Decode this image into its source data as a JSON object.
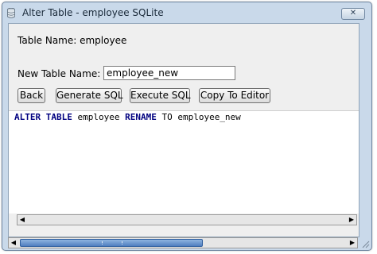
{
  "window": {
    "title": "Alter Table - employee SQLite",
    "close_glyph": "✕",
    "icon": "database-icon"
  },
  "form": {
    "table_name_label": "Table Name: employee",
    "new_table_name_label": "New Table Name:",
    "new_table_name_value": "employee_new"
  },
  "buttons": {
    "back": "Back",
    "generate_sql": "Generate SQL",
    "execute_sql": "Execute SQL",
    "copy_to_editor": "Copy To Editor"
  },
  "editor": {
    "sql": {
      "kw1": "ALTER TABLE",
      "t1": " employee ",
      "kw2": "RENAME",
      "t2": " TO employee_new"
    },
    "keyword_color": "#000080"
  },
  "scrollbars": {
    "left_arrow": "◀",
    "right_arrow": "▶"
  }
}
